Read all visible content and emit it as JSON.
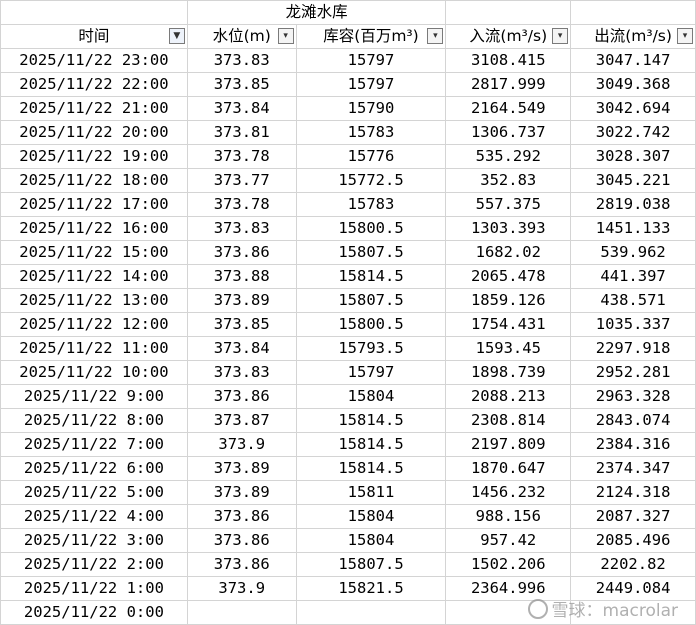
{
  "sheet": {
    "title": "龙滩水库",
    "headers": {
      "time": "时间",
      "level": "水位(m)",
      "storage": "库容(百万m³)",
      "inflow": "入流(m³/s)",
      "outflow": "出流(m³/s)"
    },
    "filter_icons": {
      "time": "▼",
      "other": "▾"
    },
    "rows": [
      [
        "2025/11/22 23:00",
        "373.83",
        "15797",
        "3108.415",
        "3047.147"
      ],
      [
        "2025/11/22 22:00",
        "373.85",
        "15797",
        "2817.999",
        "3049.368"
      ],
      [
        "2025/11/22 21:00",
        "373.84",
        "15790",
        "2164.549",
        "3042.694"
      ],
      [
        "2025/11/22 20:00",
        "373.81",
        "15783",
        "1306.737",
        "3022.742"
      ],
      [
        "2025/11/22 19:00",
        "373.78",
        "15776",
        "535.292",
        "3028.307"
      ],
      [
        "2025/11/22 18:00",
        "373.77",
        "15772.5",
        "352.83",
        "3045.221"
      ],
      [
        "2025/11/22 17:00",
        "373.78",
        "15783",
        "557.375",
        "2819.038"
      ],
      [
        "2025/11/22 16:00",
        "373.83",
        "15800.5",
        "1303.393",
        "1451.133"
      ],
      [
        "2025/11/22 15:00",
        "373.86",
        "15807.5",
        "1682.02",
        "539.962"
      ],
      [
        "2025/11/22 14:00",
        "373.88",
        "15814.5",
        "2065.478",
        "441.397"
      ],
      [
        "2025/11/22 13:00",
        "373.89",
        "15807.5",
        "1859.126",
        "438.571"
      ],
      [
        "2025/11/22 12:00",
        "373.85",
        "15800.5",
        "1754.431",
        "1035.337"
      ],
      [
        "2025/11/22 11:00",
        "373.84",
        "15793.5",
        "1593.45",
        "2297.918"
      ],
      [
        "2025/11/22 10:00",
        "373.83",
        "15797",
        "1898.739",
        "2952.281"
      ],
      [
        "2025/11/22 9:00",
        "373.86",
        "15804",
        "2088.213",
        "2963.328"
      ],
      [
        "2025/11/22 8:00",
        "373.87",
        "15814.5",
        "2308.814",
        "2843.074"
      ],
      [
        "2025/11/22 7:00",
        "373.9",
        "15814.5",
        "2197.809",
        "2384.316"
      ],
      [
        "2025/11/22 6:00",
        "373.89",
        "15814.5",
        "1870.647",
        "2374.347"
      ],
      [
        "2025/11/22 5:00",
        "373.89",
        "15811",
        "1456.232",
        "2124.318"
      ],
      [
        "2025/11/22 4:00",
        "373.86",
        "15804",
        "988.156",
        "2087.327"
      ],
      [
        "2025/11/22 3:00",
        "373.86",
        "15804",
        "957.42",
        "2085.496"
      ],
      [
        "2025/11/22 2:00",
        "373.86",
        "15807.5",
        "1502.206",
        "2202.82"
      ],
      [
        "2025/11/22 1:00",
        "373.9",
        "15821.5",
        "2364.996",
        "2449.084"
      ],
      [
        "2025/11/22 0:00",
        "",
        "",
        "",
        ""
      ]
    ]
  },
  "watermark": {
    "text": "雪球：macrolar"
  }
}
